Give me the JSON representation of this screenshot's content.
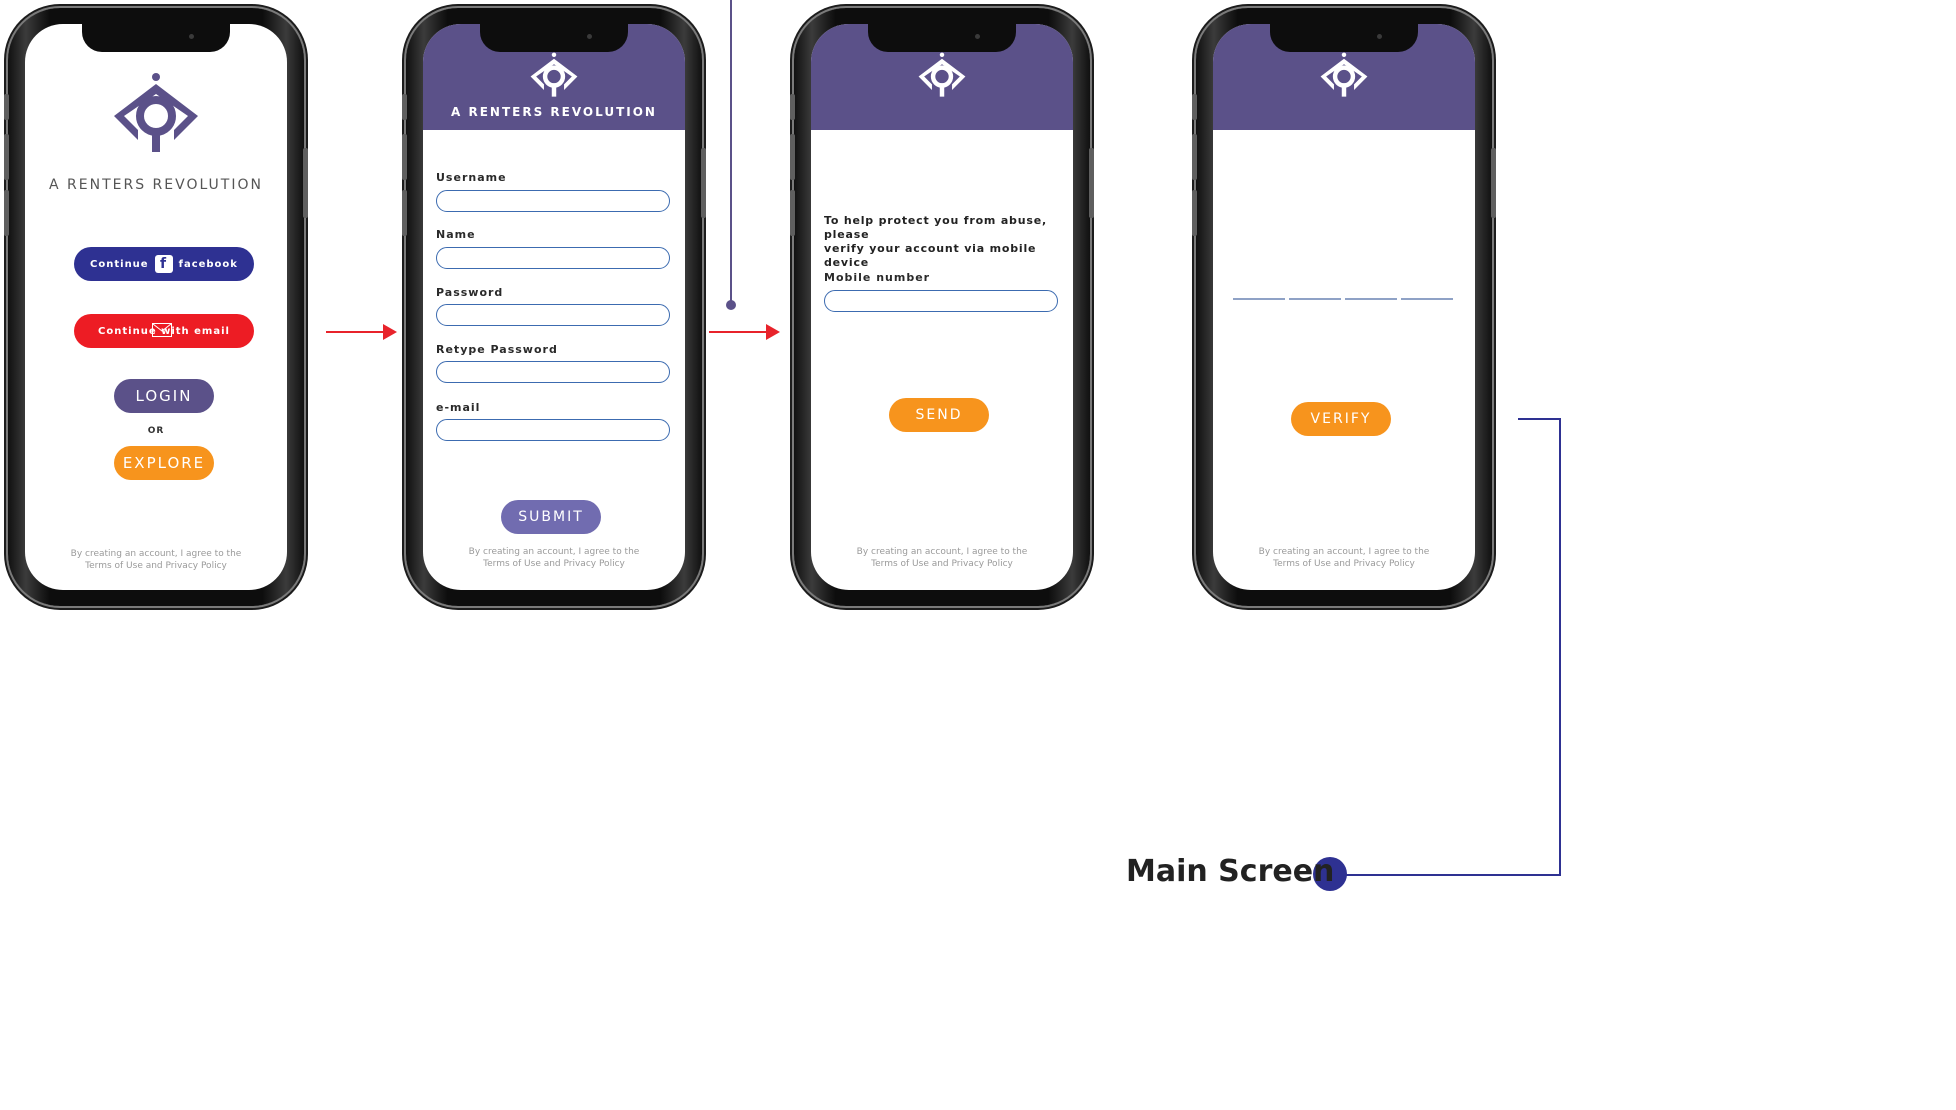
{
  "brand": {
    "tagline": "A RENTERS REVOLUTION",
    "color_primary": "#5b5189",
    "color_orange": "#f7941d",
    "color_red": "#ed1c24",
    "color_fb": "#2e3192"
  },
  "screen1": {
    "facebook_button": {
      "prefix": "Continue",
      "suffix": "facebook"
    },
    "email_button": {
      "label": "Continue with email"
    },
    "login_label": "LOGIN",
    "or_label": "OR",
    "explore_label": "EXPLORE",
    "terms": [
      "By creating an account, I agree to the",
      "Terms of Use and Privacy Policy"
    ]
  },
  "screen2": {
    "fields": [
      "Username",
      "Name",
      "Password",
      "Retype Password",
      "e-mail"
    ],
    "submit_label": "SUBMIT",
    "terms": [
      "By creating an account, I agree to the",
      "Terms of Use and Privacy Policy"
    ]
  },
  "screen3": {
    "info": [
      "To help protect you from abuse, please",
      "verify your account via mobile device"
    ],
    "mobile_label": "Mobile number",
    "send_label": "SEND",
    "terms": [
      "By creating an account, I agree to the",
      "Terms of Use and Privacy Policy"
    ]
  },
  "screen4": {
    "verify_label": "VERIFY",
    "terms": [
      "By creating an account, I agree to the",
      "Terms of Use and Privacy Policy"
    ]
  },
  "flow": {
    "main_screen_label": "Main Screen",
    "connector_color": "#2e3192"
  },
  "icons": {
    "logo": "renters-revolution-logo-icon",
    "facebook": "facebook-icon",
    "email": "envelope-icon",
    "arrow": "right-arrow-icon"
  }
}
